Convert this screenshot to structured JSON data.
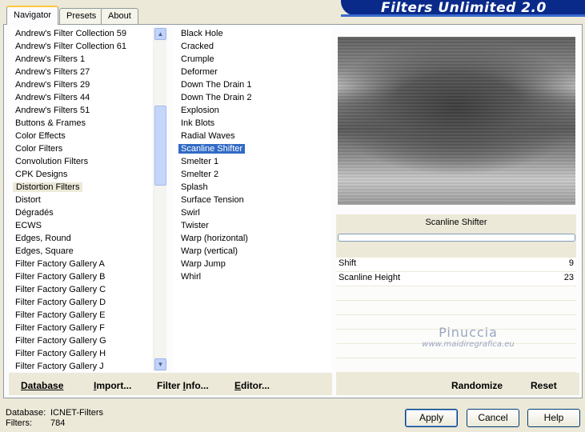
{
  "app": {
    "banner_title": "Filters Unlimited 2.0"
  },
  "tabs": [
    {
      "label": "Navigator",
      "active": true
    },
    {
      "label": "Presets",
      "active": false
    },
    {
      "label": "About",
      "active": false
    }
  ],
  "categories": {
    "items": [
      "Andrew's Filter Collection 59",
      "Andrew's Filter Collection 61",
      "Andrew's Filters 1",
      "Andrew's Filters 27",
      "Andrew's Filters 29",
      "Andrew's Filters 44",
      "Andrew's Filters 51",
      "Buttons & Frames",
      "Color Effects",
      "Color Filters",
      "Convolution Filters",
      "CPK Designs",
      "Distortion Filters",
      "Distort",
      "Dégradés",
      "ECWS",
      "Edges, Round",
      "Edges, Square",
      "Filter Factory Gallery A",
      "Filter Factory Gallery B",
      "Filter Factory Gallery C",
      "Filter Factory Gallery D",
      "Filter Factory Gallery E",
      "Filter Factory Gallery F",
      "Filter Factory Gallery G",
      "Filter Factory Gallery H",
      "Filter Factory Gallery J"
    ],
    "selected": "Distortion Filters"
  },
  "filters": {
    "items": [
      "Black Hole",
      "Cracked",
      "Crumple",
      "Deformer",
      "Down The Drain 1",
      "Down The Drain 2",
      "Explosion",
      "Ink Blots",
      "Radial Waves",
      "Scanline Shifter",
      "Smelter 1",
      "Smelter 2",
      "Splash",
      "Surface Tension",
      "Swirl",
      "Twister",
      "Warp (horizontal)",
      "Warp (vertical)",
      "Warp Jump",
      "Whirl"
    ],
    "selected": "Scanline Shifter"
  },
  "filter_panel": {
    "title": "Scanline Shifter",
    "params": [
      {
        "label": "Shift",
        "value": "9"
      },
      {
        "label": "Scanline Height",
        "value": "23"
      }
    ]
  },
  "watermark": {
    "line1": "Pinuccia",
    "line2": "www.maidiregrafica.eu"
  },
  "toolbar": {
    "database": {
      "u": "D",
      "rest": "atabase"
    },
    "import": {
      "u": "I",
      "rest": "mport..."
    },
    "filter_info": {
      "pre": "Filter ",
      "u": "I",
      "rest": "nfo..."
    },
    "editor": {
      "u": "E",
      "rest": "ditor..."
    },
    "randomize": "Randomize",
    "reset": "Reset"
  },
  "footer": {
    "database_label": "Database:",
    "database_value": "ICNET-Filters",
    "filters_label": "Filters:",
    "filters_value": "784"
  },
  "buttons": {
    "apply": "Apply",
    "cancel": "Cancel",
    "help": "Help"
  },
  "icons": {
    "scroll_up": "chevron-up-icon",
    "scroll_down": "chevron-down-icon"
  }
}
